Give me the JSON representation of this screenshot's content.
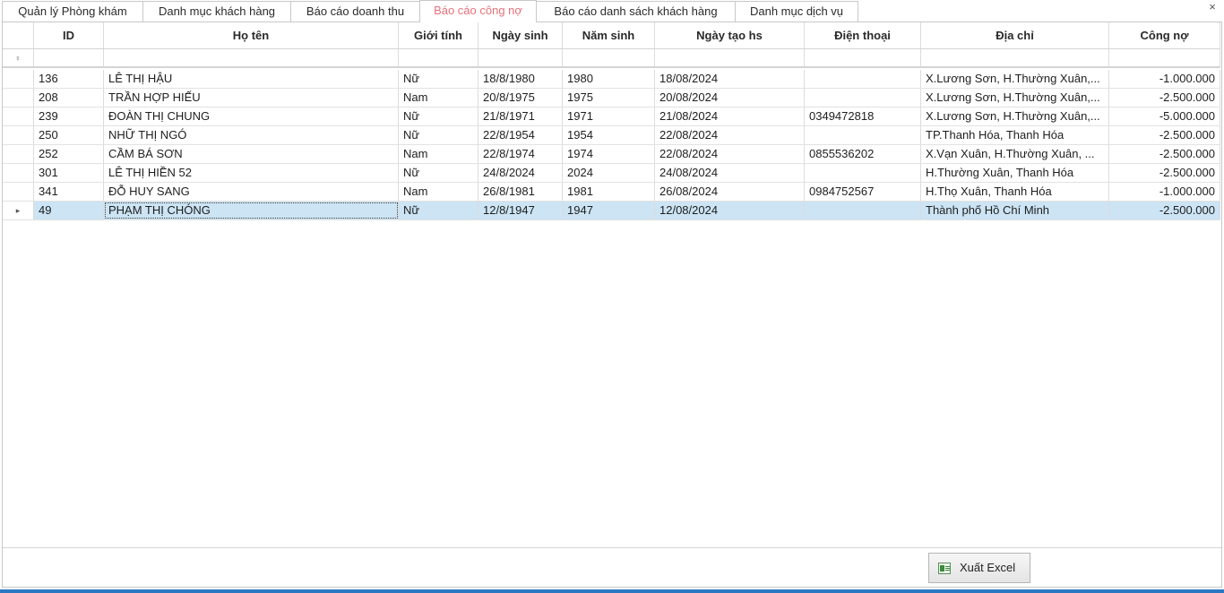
{
  "tabs": [
    {
      "label": "Quản lý Phòng khám",
      "active": false
    },
    {
      "label": "Danh mục khách hàng",
      "active": false
    },
    {
      "label": "Báo cáo doanh thu",
      "active": false
    },
    {
      "label": "Báo cáo công nợ",
      "active": true
    },
    {
      "label": "Báo cáo danh sách khách hàng",
      "active": false
    },
    {
      "label": "Danh mục dịch vụ",
      "active": false
    }
  ],
  "close_glyph": "×",
  "grid": {
    "filter_icon": "filter-pin-icon",
    "columns": [
      "ID",
      "Họ tên",
      "Giới tính",
      "Ngày sinh",
      "Năm sinh",
      "Ngày tạo hs",
      "Điện thoại",
      "Địa chỉ",
      "Công nợ"
    ],
    "rows": [
      [
        "136",
        "LÊ THỊ HẬU",
        "Nữ",
        "18/8/1980",
        "1980",
        "18/08/2024",
        "",
        "X.Lương Sơn, H.Thường Xuân,...",
        "-1.000.000"
      ],
      [
        "208",
        "TRẦN HỢP HIẾU",
        "Nam",
        "20/8/1975",
        "1975",
        "20/08/2024",
        "",
        "X.Lương Sơn, H.Thường Xuân,...",
        "-2.500.000"
      ],
      [
        "239",
        "ĐOÀN THỊ CHUNG",
        "Nữ",
        "21/8/1971",
        "1971",
        "21/08/2024",
        "0349472818",
        "X.Lương Sơn, H.Thường Xuân,...",
        "-5.000.000"
      ],
      [
        "250",
        "NHỮ THỊ NGÓ",
        "Nữ",
        "22/8/1954",
        "1954",
        "22/08/2024",
        "",
        "TP.Thanh Hóa, Thanh Hóa",
        "-2.500.000"
      ],
      [
        "252",
        "CẦM BÁ SƠN",
        "Nam",
        "22/8/1974",
        "1974",
        "22/08/2024",
        "0855536202",
        "X.Vạn Xuân, H.Thường Xuân, ...",
        "-2.500.000"
      ],
      [
        "301",
        "LÊ THỊ HIỀN 52",
        "Nữ",
        "24/8/2024",
        "2024",
        "24/08/2024",
        "",
        "H.Thường Xuân, Thanh Hóa",
        "-2.500.000"
      ],
      [
        "341",
        "ĐỖ HUY SANG",
        "Nam",
        "26/8/1981",
        "1981",
        "26/08/2024",
        "0984752567",
        "H.Thọ Xuân, Thanh Hóa",
        "-1.000.000"
      ],
      [
        "49",
        "PHẠM THỊ CHÓNG",
        "Nữ",
        "12/8/1947",
        "1947",
        "12/08/2024",
        "",
        "Thành phố Hồ Chí Minh",
        "-2.500.000"
      ]
    ],
    "selected_row": 7,
    "row_indicator_glyph": "▸",
    "filter_glyph": "♀"
  },
  "export_button": {
    "label": "Xuất Excel",
    "icon": "excel-icon"
  },
  "colors": {
    "active_tab": "#e8707a",
    "selected_row": "#cce4f4",
    "status_strip": "#2b78c2"
  }
}
